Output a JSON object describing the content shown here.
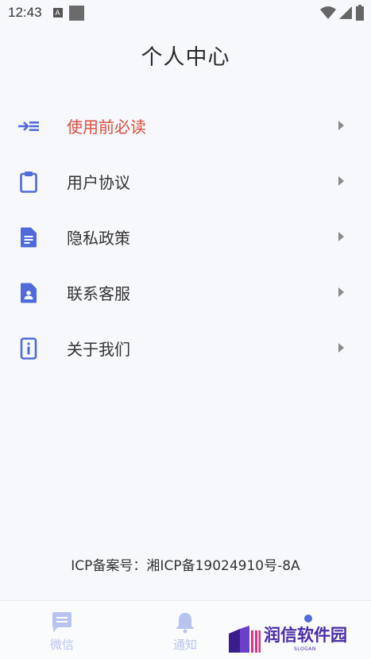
{
  "status_bar": {
    "time": "12:43",
    "badge": "A"
  },
  "page": {
    "title": "个人中心"
  },
  "menu": {
    "items": [
      {
        "label": "使用前必读",
        "icon": "arrow-list-icon",
        "highlight": true
      },
      {
        "label": "用户协议",
        "icon": "clipboard-icon"
      },
      {
        "label": "隐私政策",
        "icon": "document-icon"
      },
      {
        "label": "联系客服",
        "icon": "contact-card-icon"
      },
      {
        "label": "关于我们",
        "icon": "info-icon"
      }
    ]
  },
  "footer": {
    "icp": "ICP备案号：湘ICP备19024910号-8A"
  },
  "tabbar": {
    "tabs": [
      {
        "label": "微信",
        "icon": "chat-icon"
      },
      {
        "label": "通知",
        "icon": "bell-icon"
      }
    ]
  },
  "watermark": {
    "title": "润信软件园",
    "slogan": "SLOGAN"
  },
  "colors": {
    "accent": "#4f6bdc",
    "highlight": "#e04b3c",
    "tab_inactive": "#b8c4f0",
    "watermark": "#4a2ca6"
  }
}
